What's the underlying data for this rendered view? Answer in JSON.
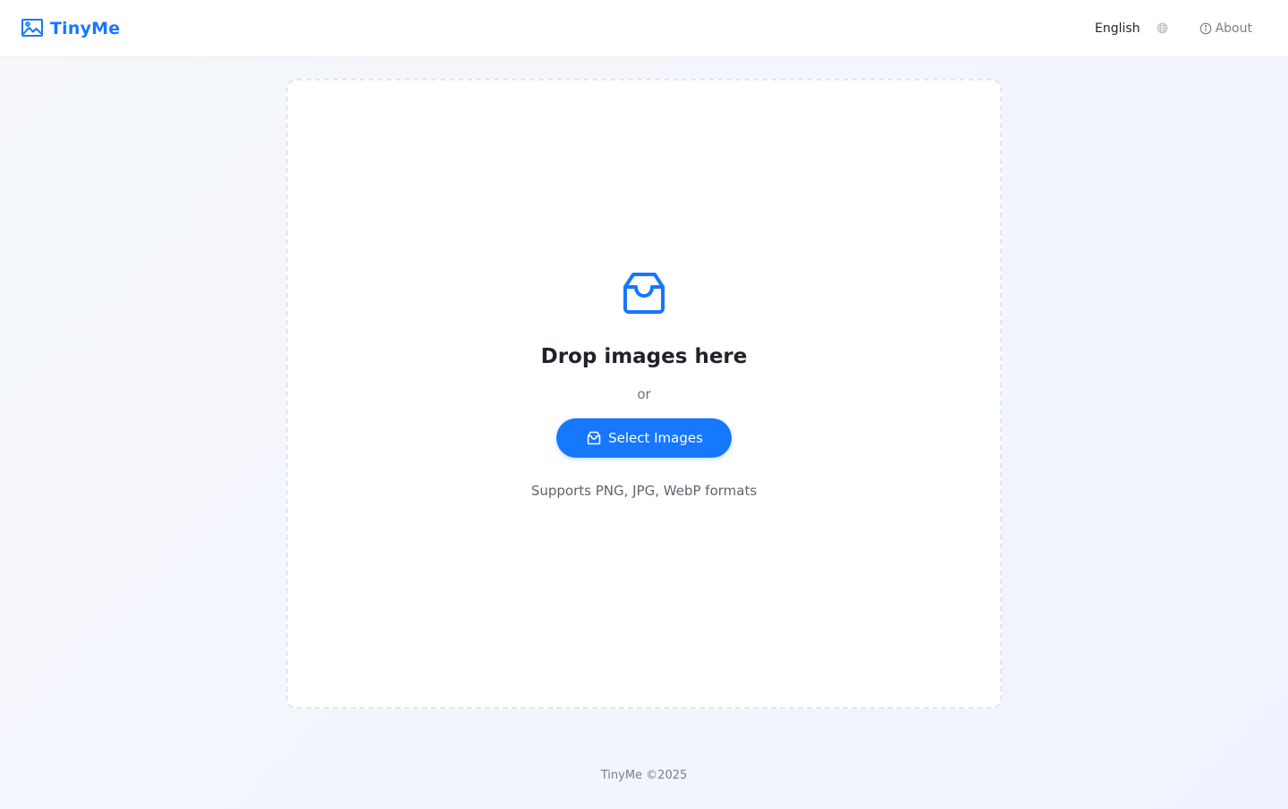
{
  "header": {
    "brand": {
      "name": "TinyMe",
      "icon": "image-icon"
    },
    "language": {
      "selected": "English",
      "icon": "globe-icon"
    },
    "about": {
      "label": "About",
      "icon": "info-circle-icon"
    }
  },
  "dropzone": {
    "icon": "inbox-icon",
    "title": "Drop images here",
    "or_text": "or",
    "select_button": {
      "label": "Select Images",
      "icon": "inbox-icon"
    },
    "formats_text": "Supports PNG, JPG, WebP formats"
  },
  "footer": {
    "text": "TinyMe ©2025"
  },
  "colors": {
    "accent": "#1677ff",
    "background": "#f3f6fc",
    "text": "#1f2329",
    "muted": "#7a7f87"
  }
}
